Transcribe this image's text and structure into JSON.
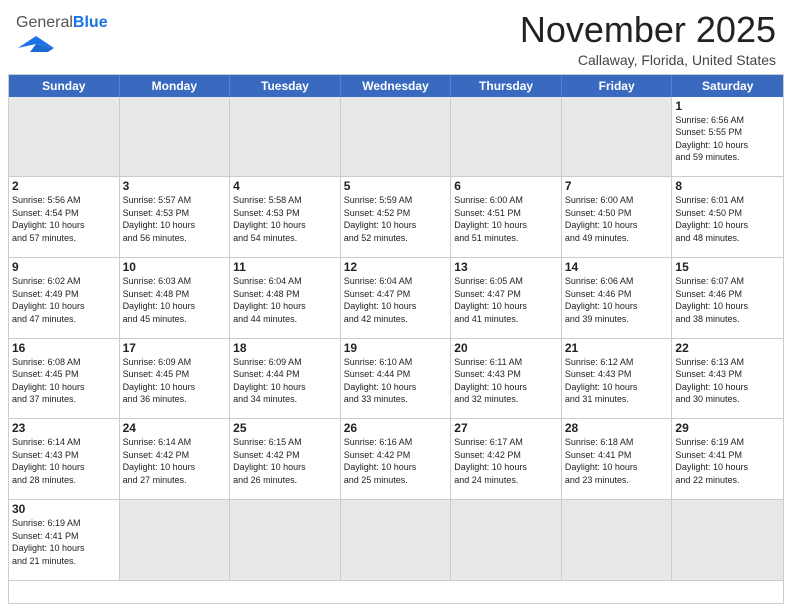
{
  "header": {
    "logo_general": "General",
    "logo_blue": "Blue",
    "month_title": "November 2025",
    "location": "Callaway, Florida, United States"
  },
  "days_of_week": [
    "Sunday",
    "Monday",
    "Tuesday",
    "Wednesday",
    "Thursday",
    "Friday",
    "Saturday"
  ],
  "cells": [
    {
      "day": "",
      "info": "",
      "shaded": true
    },
    {
      "day": "",
      "info": "",
      "shaded": true
    },
    {
      "day": "",
      "info": "",
      "shaded": true
    },
    {
      "day": "",
      "info": "",
      "shaded": true
    },
    {
      "day": "",
      "info": "",
      "shaded": true
    },
    {
      "day": "",
      "info": "",
      "shaded": true
    },
    {
      "day": "1",
      "info": "Sunrise: 6:56 AM\nSunset: 5:55 PM\nDaylight: 10 hours\nand 59 minutes."
    },
    {
      "day": "2",
      "info": "Sunrise: 5:56 AM\nSunset: 4:54 PM\nDaylight: 10 hours\nand 57 minutes."
    },
    {
      "day": "3",
      "info": "Sunrise: 5:57 AM\nSunset: 4:53 PM\nDaylight: 10 hours\nand 56 minutes."
    },
    {
      "day": "4",
      "info": "Sunrise: 5:58 AM\nSunset: 4:53 PM\nDaylight: 10 hours\nand 54 minutes."
    },
    {
      "day": "5",
      "info": "Sunrise: 5:59 AM\nSunset: 4:52 PM\nDaylight: 10 hours\nand 52 minutes."
    },
    {
      "day": "6",
      "info": "Sunrise: 6:00 AM\nSunset: 4:51 PM\nDaylight: 10 hours\nand 51 minutes."
    },
    {
      "day": "7",
      "info": "Sunrise: 6:00 AM\nSunset: 4:50 PM\nDaylight: 10 hours\nand 49 minutes."
    },
    {
      "day": "8",
      "info": "Sunrise: 6:01 AM\nSunset: 4:50 PM\nDaylight: 10 hours\nand 48 minutes."
    },
    {
      "day": "9",
      "info": "Sunrise: 6:02 AM\nSunset: 4:49 PM\nDaylight: 10 hours\nand 47 minutes."
    },
    {
      "day": "10",
      "info": "Sunrise: 6:03 AM\nSunset: 4:48 PM\nDaylight: 10 hours\nand 45 minutes."
    },
    {
      "day": "11",
      "info": "Sunrise: 6:04 AM\nSunset: 4:48 PM\nDaylight: 10 hours\nand 44 minutes."
    },
    {
      "day": "12",
      "info": "Sunrise: 6:04 AM\nSunset: 4:47 PM\nDaylight: 10 hours\nand 42 minutes."
    },
    {
      "day": "13",
      "info": "Sunrise: 6:05 AM\nSunset: 4:47 PM\nDaylight: 10 hours\nand 41 minutes."
    },
    {
      "day": "14",
      "info": "Sunrise: 6:06 AM\nSunset: 4:46 PM\nDaylight: 10 hours\nand 39 minutes."
    },
    {
      "day": "15",
      "info": "Sunrise: 6:07 AM\nSunset: 4:46 PM\nDaylight: 10 hours\nand 38 minutes."
    },
    {
      "day": "16",
      "info": "Sunrise: 6:08 AM\nSunset: 4:45 PM\nDaylight: 10 hours\nand 37 minutes."
    },
    {
      "day": "17",
      "info": "Sunrise: 6:09 AM\nSunset: 4:45 PM\nDaylight: 10 hours\nand 36 minutes."
    },
    {
      "day": "18",
      "info": "Sunrise: 6:09 AM\nSunset: 4:44 PM\nDaylight: 10 hours\nand 34 minutes."
    },
    {
      "day": "19",
      "info": "Sunrise: 6:10 AM\nSunset: 4:44 PM\nDaylight: 10 hours\nand 33 minutes."
    },
    {
      "day": "20",
      "info": "Sunrise: 6:11 AM\nSunset: 4:43 PM\nDaylight: 10 hours\nand 32 minutes."
    },
    {
      "day": "21",
      "info": "Sunrise: 6:12 AM\nSunset: 4:43 PM\nDaylight: 10 hours\nand 31 minutes."
    },
    {
      "day": "22",
      "info": "Sunrise: 6:13 AM\nSunset: 4:43 PM\nDaylight: 10 hours\nand 30 minutes."
    },
    {
      "day": "23",
      "info": "Sunrise: 6:14 AM\nSunset: 4:43 PM\nDaylight: 10 hours\nand 28 minutes."
    },
    {
      "day": "24",
      "info": "Sunrise: 6:14 AM\nSunset: 4:42 PM\nDaylight: 10 hours\nand 27 minutes."
    },
    {
      "day": "25",
      "info": "Sunrise: 6:15 AM\nSunset: 4:42 PM\nDaylight: 10 hours\nand 26 minutes."
    },
    {
      "day": "26",
      "info": "Sunrise: 6:16 AM\nSunset: 4:42 PM\nDaylight: 10 hours\nand 25 minutes."
    },
    {
      "day": "27",
      "info": "Sunrise: 6:17 AM\nSunset: 4:42 PM\nDaylight: 10 hours\nand 24 minutes."
    },
    {
      "day": "28",
      "info": "Sunrise: 6:18 AM\nSunset: 4:41 PM\nDaylight: 10 hours\nand 23 minutes."
    },
    {
      "day": "29",
      "info": "Sunrise: 6:19 AM\nSunset: 4:41 PM\nDaylight: 10 hours\nand 22 minutes."
    },
    {
      "day": "30",
      "info": "Sunrise: 6:19 AM\nSunset: 4:41 PM\nDaylight: 10 hours\nand 21 minutes."
    },
    {
      "day": "",
      "info": "",
      "shaded": true
    },
    {
      "day": "",
      "info": "",
      "shaded": true
    },
    {
      "day": "",
      "info": "",
      "shaded": true
    },
    {
      "day": "",
      "info": "",
      "shaded": true
    },
    {
      "day": "",
      "info": "",
      "shaded": true
    },
    {
      "day": "",
      "info": "",
      "shaded": true
    }
  ]
}
